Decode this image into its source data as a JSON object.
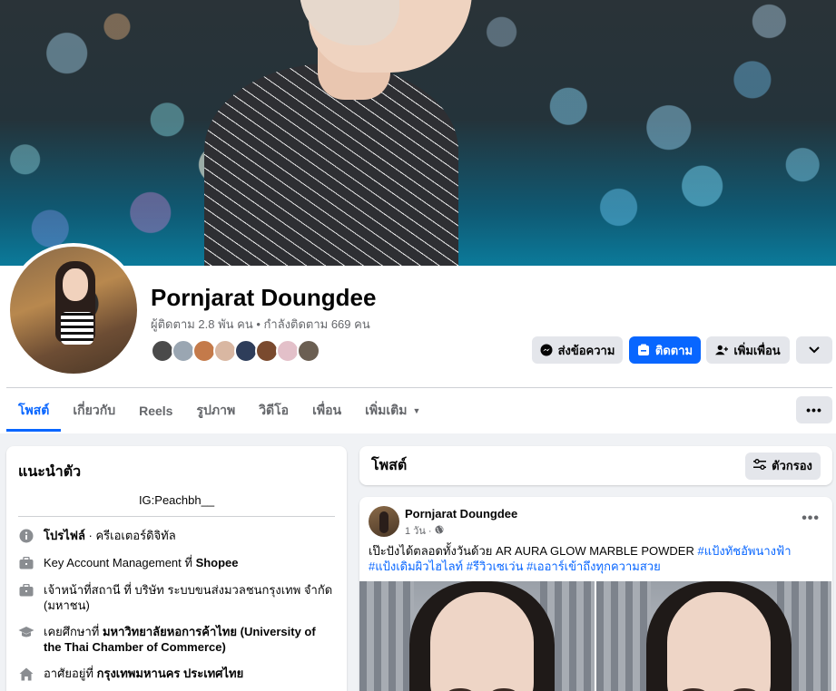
{
  "profile": {
    "name": "Pornjarat Doungdee",
    "stats": "ผู้ติดตาม 2.8 พัน คน • กำลังติดตาม 669 คน"
  },
  "actions": {
    "message": "ส่งข้อความ",
    "follow": "ติดตาม",
    "add_friend": "เพิ่มเพื่อน"
  },
  "tabs": [
    {
      "label": "โพสต์"
    },
    {
      "label": "เกี่ยวกับ"
    },
    {
      "label": "Reels"
    },
    {
      "label": "รูปภาพ"
    },
    {
      "label": "วิดีโอ"
    },
    {
      "label": "เพื่อน"
    },
    {
      "label": "เพิ่มเติม"
    }
  ],
  "intro": {
    "title": "แนะนำตัว",
    "bio": "IG:Peachbh__",
    "items": [
      {
        "icon": "info-icon",
        "bold_prefix": "โปรไฟล์",
        "text": " · ครีเอเตอร์ดิจิทัล"
      },
      {
        "icon": "briefcase-icon",
        "text": "Key Account Management ที่ ",
        "bold": "Shopee"
      },
      {
        "icon": "briefcase-icon",
        "text": "เจ้าหน้าที่สถานี ที่ บริษัท ระบบขนส่งมวลชนกรุงเทพ จำกัด (มหาชน)"
      },
      {
        "icon": "graduation-cap-icon",
        "text": "เคยศึกษาที่ ",
        "bold": "มหาวิทยาลัยหอการค้าไทย (University of the Thai Chamber of Commerce)"
      },
      {
        "icon": "home-icon",
        "text": "อาศัยอยู่ที่ ",
        "bold": "กรุงเทพมหานคร ประเทศไทย"
      }
    ]
  },
  "posts_header": {
    "title": "โพสต์",
    "filter": "ตัวกรอง"
  },
  "post": {
    "author": "Pornjarat Doungdee",
    "time": "1 วัน ·",
    "text": "เป๊ะปังได้ตลอดทั้งวันด้วย AR AURA GLOW MARBLE POWDER ",
    "tags": [
      "#แป้งทัชอัพนางฟ้า",
      "#แป้งเดิมผิวไฮไลท์",
      "#รีวิวเซเว่น",
      "#เออาร์เข้าถึงทุกความสวย"
    ]
  },
  "colors": {
    "accent": "#0866ff",
    "page_bg": "#f0f2f5",
    "secondary_text": "#65676b"
  }
}
